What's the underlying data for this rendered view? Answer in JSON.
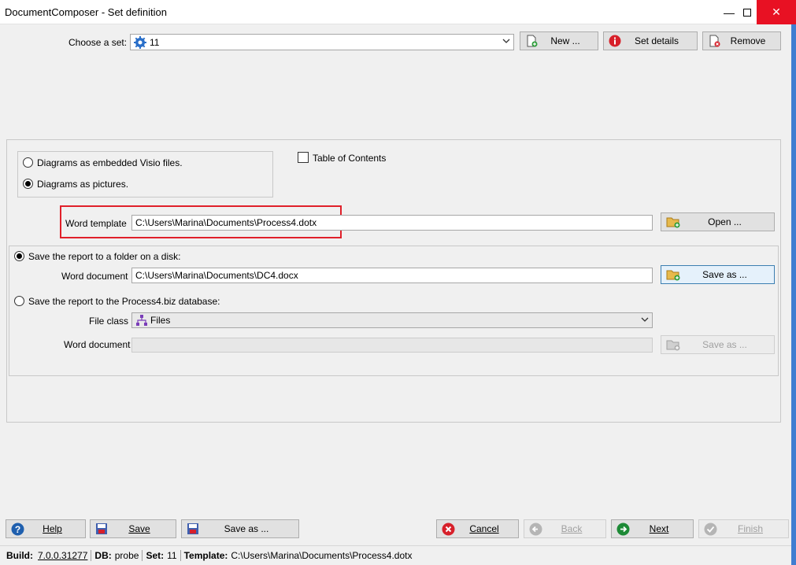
{
  "window": {
    "title": "DocumentComposer - Set definition"
  },
  "set": {
    "label": "Choose a set:",
    "value": "11",
    "new_label": "New ...",
    "details_label": "Set details",
    "remove_label": "Remove"
  },
  "options": {
    "diagrams_visio": "Diagrams as embedded Visio files.",
    "diagrams_pictures": "Diagrams as pictures.",
    "diagrams_selected": "pictures",
    "toc_label": "Table of Contents",
    "toc_checked": false
  },
  "template": {
    "label": "Word template",
    "value": "C:\\Users\\Marina\\Documents\\Process4.dotx",
    "open_label": "Open ..."
  },
  "save_folder": {
    "label": "Save the report to a folder on a disk:",
    "selected": true,
    "doc_label": "Word document",
    "doc_value": "C:\\Users\\Marina\\Documents\\DC4.docx",
    "save_as_label": "Save as ..."
  },
  "save_db": {
    "label": "Save the report to the Process4.biz database:",
    "selected": false,
    "file_class_label": "File class",
    "file_class_value": "Files",
    "doc_label": "Word document",
    "doc_value": "",
    "save_as_label": "Save as ..."
  },
  "footer": {
    "help": "Help",
    "save": "Save",
    "save_as": "Save as ...",
    "cancel": "Cancel",
    "back": "Back",
    "next": "Next",
    "finish": "Finish"
  },
  "status": {
    "build_label": "Build:",
    "build_value": "7.0.0.31277",
    "db_label": "DB:",
    "db_value": "probe",
    "set_label": "Set:",
    "set_value": "11",
    "template_label": "Template:",
    "template_value": "C:\\Users\\Marina\\Documents\\Process4.dotx"
  },
  "colors": {
    "highlight_box": "#e0202a",
    "close_button": "#e81123",
    "accent_blue": "#3f7dd1"
  }
}
